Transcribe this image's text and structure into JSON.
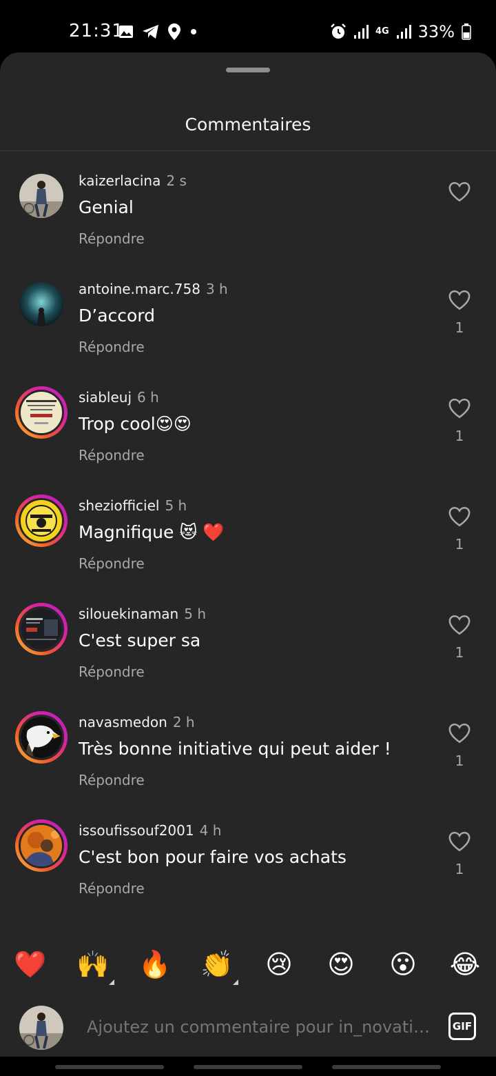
{
  "status_bar": {
    "time": "21:31",
    "left_icons": [
      "gallery-icon",
      "telegram-icon",
      "location-icon",
      "dot-icon"
    ],
    "right_icons": [
      "alarm-icon",
      "signal-icon",
      "4g-icon",
      "signal-icon"
    ],
    "network_label": "4G",
    "battery_percent": "33%"
  },
  "sheet": {
    "title": "Commentaires"
  },
  "comments": [
    {
      "username": "kaizerlacina",
      "time": "2 s",
      "text": "Genial",
      "reply": "Répondre",
      "likes": ""
    },
    {
      "username": "antoine.marc.758",
      "time": "3 h",
      "text": "D’accord",
      "reply": "Répondre",
      "likes": "1"
    },
    {
      "username": "siableuj",
      "time": "6 h",
      "text": "Trop cool😍😍",
      "reply": "Répondre",
      "likes": "1"
    },
    {
      "username": "sheziofficiel",
      "time": "5 h",
      "text": "Magnifique 😻 ❤️",
      "reply": "Répondre",
      "likes": "1"
    },
    {
      "username": "silouekinaman",
      "time": "5 h",
      "text": "C'est super sa",
      "reply": "Répondre",
      "likes": "1"
    },
    {
      "username": "navasmedon",
      "time": "2 h",
      "text": "Très bonne initiative qui peut aider !",
      "reply": "Répondre",
      "likes": "1"
    },
    {
      "username": "issoufissouf2001",
      "time": "4 h",
      "text": "C'est bon pour faire vos achats",
      "reply": "Répondre",
      "likes": "1"
    }
  ],
  "emoji_bar": [
    "❤️",
    "🙌",
    "🔥",
    "👏",
    "😢",
    "😍",
    "😮",
    "😂"
  ],
  "compose": {
    "placeholder": "Ajoutez un commentaire pour in_novationx...",
    "gif_label": "GIF"
  },
  "colors": {
    "sheet_bg": "#262626",
    "secondary_text": "#a8a8a8",
    "story_ring": "#d6249f"
  }
}
